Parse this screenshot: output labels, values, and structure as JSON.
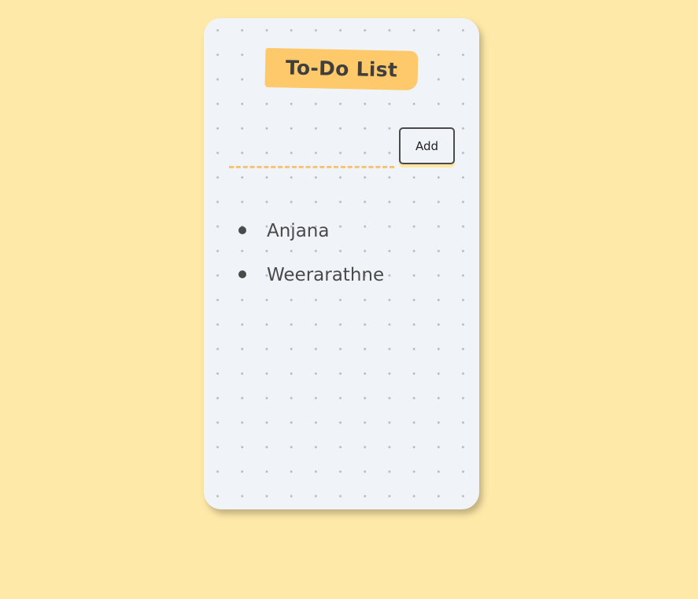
{
  "app": {
    "title": "To-Do List"
  },
  "form": {
    "input_value": "",
    "input_placeholder": "",
    "add_label": "Add"
  },
  "tasks": [
    {
      "label": "Anjana"
    },
    {
      "label": "Weerarathne"
    }
  ],
  "colors": {
    "page_background": "#ffe9a8",
    "card_background": "#f0f4f8",
    "title_highlight": "#fec96b",
    "input_underline": "#f7c477",
    "text": "#4a4a4a"
  }
}
